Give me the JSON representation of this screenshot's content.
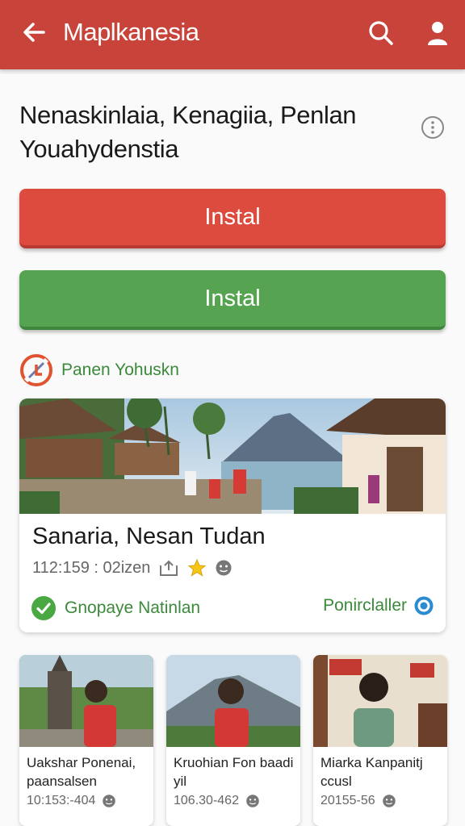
{
  "header": {
    "title": "Maplkanesia",
    "color": "#c8443b"
  },
  "app": {
    "title": "Nenaskinlaia, Kenagiia, Penlan Youahydenstia"
  },
  "buttons": {
    "primary_label": "Instal",
    "secondary_label": "Instal"
  },
  "developer": {
    "name": "Panen Yohuskn"
  },
  "featured": {
    "title": "Sanaria, Nesan Tudan",
    "meta": "112:159 : 02izen",
    "verified_label": "Gnopaye Natinlan",
    "right_label": "Ponirclaller"
  },
  "thumbnails": [
    {
      "title": "Uakshar Ponenai, paansalsen",
      "meta": "10:153:-404"
    },
    {
      "title": "Kruohian Fon baadi yil",
      "meta": "106.30-462"
    },
    {
      "title": "Miarka Kanpanitj ccusl",
      "meta": "20155-56"
    }
  ],
  "icons": {
    "back": "arrow-left-icon",
    "search": "search-icon",
    "user": "user-icon",
    "more": "more-vertical-icon",
    "developer": "developer-logo-icon",
    "verified": "check-circle-icon",
    "share": "share-icon",
    "star": "star-icon",
    "emoji": "emoji-icon",
    "target": "target-icon"
  },
  "colors": {
    "install_red": "#dd4a3e",
    "install_green": "#56a451",
    "accent_green": "#3a8a3a"
  }
}
